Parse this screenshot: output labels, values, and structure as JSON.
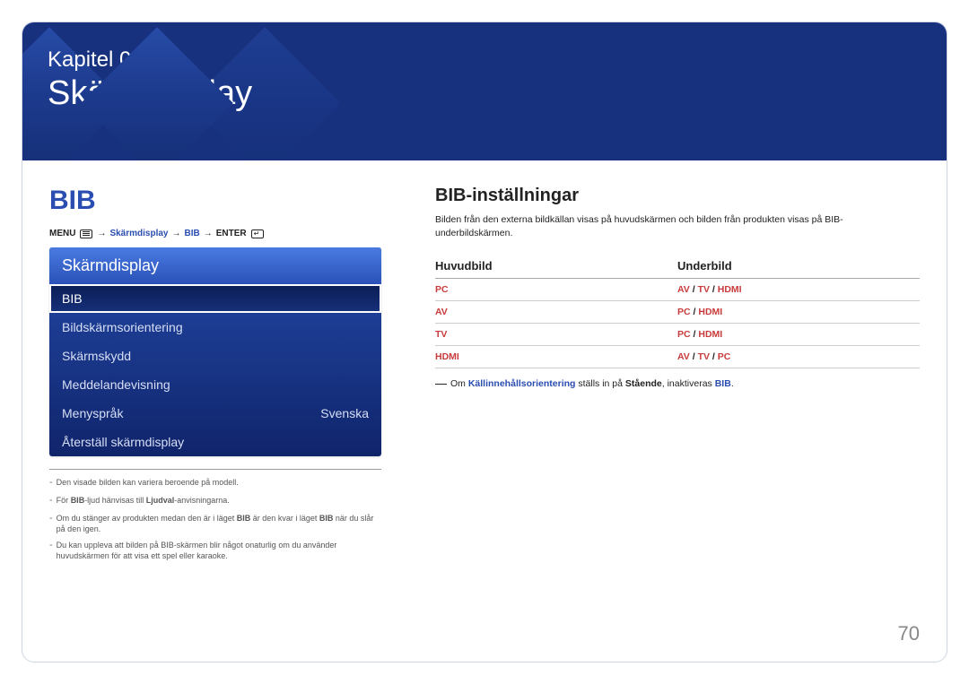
{
  "banner": {
    "chapter": "Kapitel 06",
    "title": "Skärmdisplay"
  },
  "left": {
    "heading": "BIB",
    "path": {
      "p0": "MENU",
      "p1": "Skärmdisplay",
      "p2": "BIB",
      "p3": "ENTER",
      "arrow": "→"
    },
    "osd": {
      "header": "Skärmdisplay",
      "items": [
        {
          "label": "BIB",
          "value": "",
          "selected": true
        },
        {
          "label": "Bildskärmsorientering",
          "value": "",
          "selected": false
        },
        {
          "label": "Skärmskydd",
          "value": "",
          "selected": false
        },
        {
          "label": "Meddelandevisning",
          "value": "",
          "selected": false
        },
        {
          "label": "Menyspråk",
          "value": "Svenska",
          "selected": false
        },
        {
          "label": "Återställ skärmdisplay",
          "value": "",
          "selected": false
        }
      ]
    },
    "notes": [
      {
        "pre": "Den visade bilden kan variera beroende på modell.",
        "bold1": "",
        "mid": "",
        "bold2": "",
        "post": ""
      },
      {
        "pre": "För ",
        "bold1": "BIB",
        "mid": "-ljud hänvisas till ",
        "bold2": "Ljudval",
        "post": "-anvisningarna."
      },
      {
        "pre": "Om du stänger av produkten medan den är i läget ",
        "bold1": "BIB",
        "mid": " är den kvar i läget ",
        "bold2": "BIB",
        "post": " när du slår på den igen."
      },
      {
        "pre": "Du kan uppleva att bilden på BIB-skärmen blir något onaturlig om du använder huvudskärmen för att visa ett spel eller karaoke.",
        "bold1": "",
        "mid": "",
        "bold2": "",
        "post": ""
      }
    ]
  },
  "right": {
    "title": "BIB-inställningar",
    "desc": "Bilden från den externa bildkällan visas på huvudskärmen och bilden från produkten visas på BIB-underbildskärmen.",
    "table": {
      "col1": "Huvudbild",
      "col2": "Underbild",
      "rows": [
        {
          "k": "PC",
          "v": [
            "AV",
            "TV",
            "HDMI"
          ]
        },
        {
          "k": "AV",
          "v": [
            "PC",
            "HDMI"
          ]
        },
        {
          "k": "TV",
          "v": [
            "PC",
            "HDMI"
          ]
        },
        {
          "k": "HDMI",
          "v": [
            "AV",
            "TV",
            "PC"
          ]
        }
      ]
    },
    "note": {
      "a": "Om ",
      "b1": "Källinnehållsorientering",
      "b": " ställs in på ",
      "b2": "Stående",
      "c": ", inaktiveras ",
      "b3": "BIB",
      "d": "."
    }
  },
  "page_number": "70"
}
